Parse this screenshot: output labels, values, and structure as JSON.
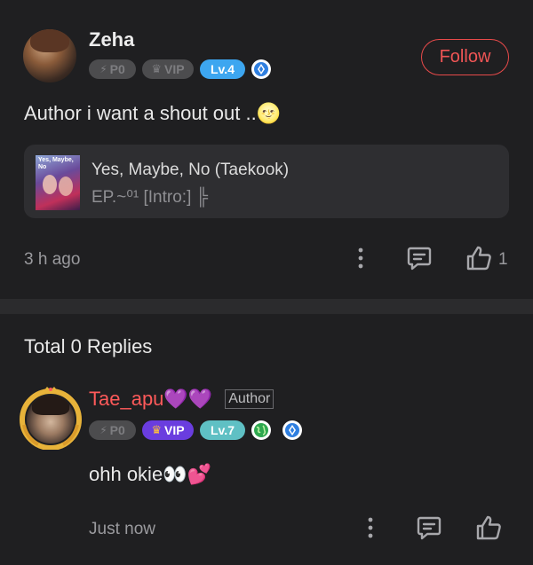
{
  "comment": {
    "author": "Zeha",
    "badges": {
      "p": "P0",
      "vip": "VIP",
      "level": "Lv.4"
    },
    "follow_label": "Follow",
    "text": "Author i want a shout out ..",
    "emoji": "🌝",
    "story": {
      "title": "Yes, Maybe, No (Taekook)",
      "episode": "EP.~⁰¹ [Intro:] ╠",
      "cover_text": "Yes, Maybe, No"
    },
    "time": "3 h ago",
    "like_count": "1"
  },
  "replies": {
    "total_label": "Total 0 Replies"
  },
  "reply": {
    "author": "Tae_apu",
    "hearts": "💜💜",
    "role_tag": "Author",
    "badges": {
      "p": "P0",
      "vip": "VIP",
      "level": "Lv.7"
    },
    "text": "ohh okie",
    "emoji": "👀💕",
    "time": "Just now"
  },
  "colors": {
    "follow": "#e84a4a",
    "reply_author": "#ff5a5a",
    "level_blue": "#3da6f0",
    "level_teal": "#5fc0c4",
    "vip_purple": "#6a3ddf"
  },
  "icons": [
    "lightning-icon",
    "crown-icon",
    "diamond-icon",
    "more-icon",
    "comment-icon",
    "like-icon",
    "globe-icon"
  ]
}
